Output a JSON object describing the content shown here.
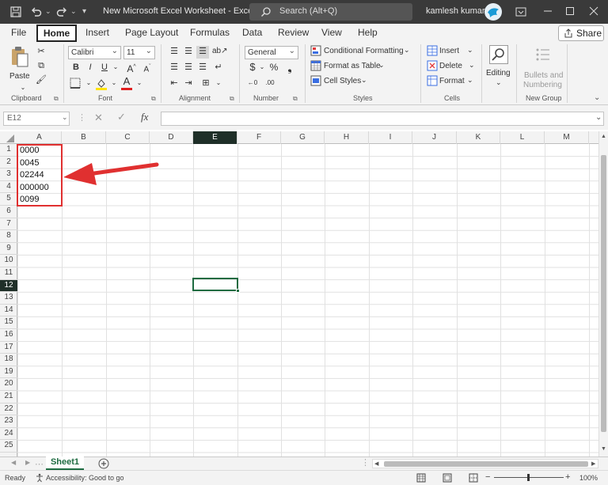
{
  "title_bar": {
    "doc_title": "New Microsoft Excel Worksheet  -  Excel",
    "search_placeholder": "Search (Alt+Q)",
    "user_name": "kamlesh kumar"
  },
  "menu": {
    "tabs": [
      "File",
      "Home",
      "Insert",
      "Page Layout",
      "Formulas",
      "Data",
      "Review",
      "View",
      "Help"
    ],
    "share_label": "Share"
  },
  "ribbon": {
    "clipboard": {
      "label": "Clipboard",
      "paste_label": "Paste"
    },
    "font": {
      "label": "Font",
      "font_name": "Calibri",
      "font_size": "11",
      "bold": "B",
      "italic": "I",
      "underline": "U"
    },
    "alignment": {
      "label": "Alignment"
    },
    "number": {
      "label": "Number",
      "format": "General"
    },
    "styles": {
      "label": "Styles",
      "items": [
        "Conditional Formatting",
        "Format as Table",
        "Cell Styles"
      ]
    },
    "cells": {
      "label": "Cells",
      "items": [
        "Insert",
        "Delete",
        "Format"
      ]
    },
    "editing": {
      "label": "Editing"
    },
    "new_group": {
      "label": "New Group",
      "button_line1": "Bullets and",
      "button_line2": "Numbering"
    }
  },
  "formula_bar": {
    "name_box": "E12",
    "fx": "fx",
    "value": ""
  },
  "grid": {
    "columns": [
      "A",
      "B",
      "C",
      "D",
      "E",
      "F",
      "G",
      "H",
      "I",
      "J",
      "K",
      "L",
      "M"
    ],
    "selected_column": "E",
    "rows": [
      "1",
      "2",
      "3",
      "4",
      "5",
      "6",
      "7",
      "8",
      "9",
      "10",
      "11",
      "12",
      "13",
      "14",
      "15",
      "16",
      "17",
      "18",
      "19",
      "20",
      "21",
      "22",
      "23",
      "24",
      "25"
    ],
    "selected_row": "12",
    "column_a_values": [
      "0000",
      "0045",
      "02244",
      "000000",
      "0099"
    ],
    "annotation_color": "#e03030"
  },
  "sheets": {
    "active": "Sheet1"
  },
  "status": {
    "ready": "Ready",
    "accessibility": "Accessibility: Good to go",
    "zoom": "100%"
  }
}
